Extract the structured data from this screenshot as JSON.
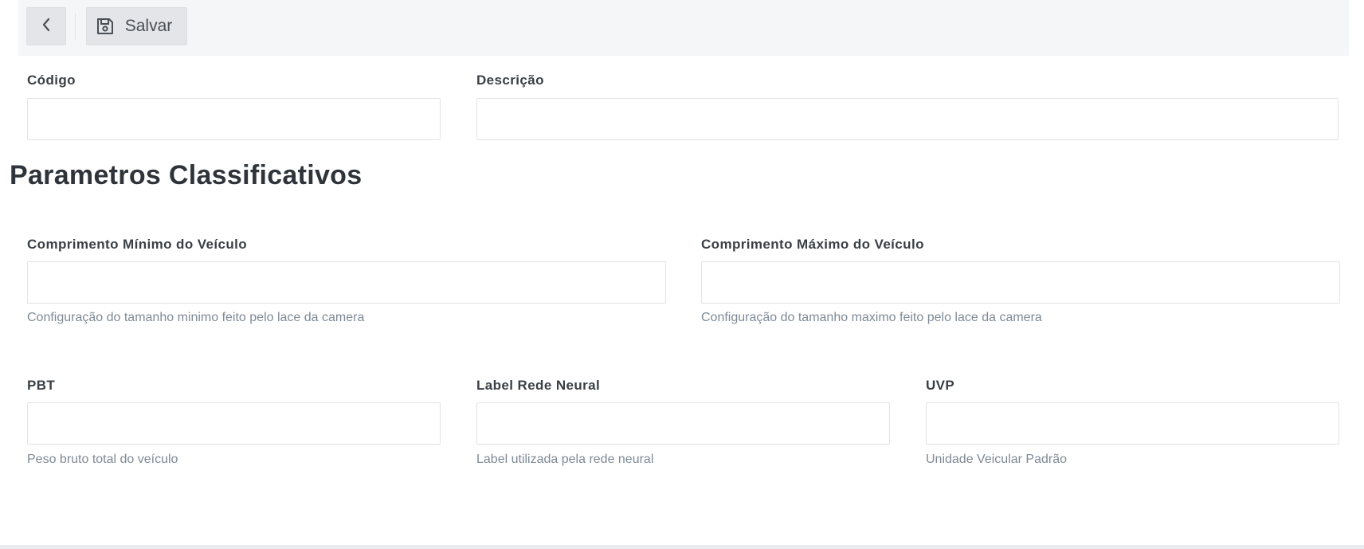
{
  "toolbar": {
    "back_icon": "chevron-left-icon",
    "save_icon": "floppy-disk-icon",
    "save_label": "Salvar"
  },
  "fields": {
    "codigo": {
      "label": "Código",
      "value": ""
    },
    "descricao": {
      "label": "Descrição",
      "value": ""
    }
  },
  "section": {
    "title": "Parametros Classificativos"
  },
  "params": {
    "comprimento_minimo": {
      "label": "Comprimento Mínimo do Veículo",
      "value": "",
      "help": "Configuração do tamanho minimo feito pelo lace da camera"
    },
    "comprimento_maximo": {
      "label": "Comprimento Máximo do Veículo",
      "value": "",
      "help": "Configuração do tamanho maximo feito pelo lace da camera"
    },
    "pbt": {
      "label": "PBT",
      "value": "",
      "help": "Peso bruto total do veículo"
    },
    "label_rede_neural": {
      "label": "Label Rede Neural",
      "value": "",
      "help": "Label utilizada pela rede neural"
    },
    "uvp": {
      "label": "UVP",
      "value": "",
      "help": "Unidade Veicular Padrão"
    }
  }
}
